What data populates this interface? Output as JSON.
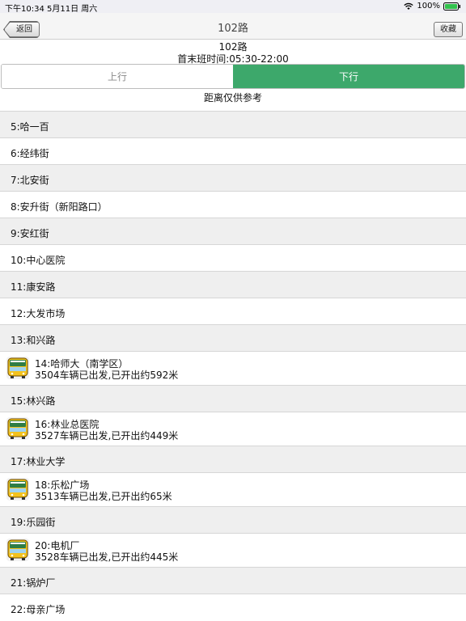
{
  "status_bar": {
    "time_date": "下午10:34   5月11日 周六",
    "battery": "100%"
  },
  "nav": {
    "back_label": "返回",
    "title": "102路",
    "favorite_label": "收藏"
  },
  "route": {
    "name": "102路",
    "hours": "首末班时间:05:30-22:00"
  },
  "direction_tabs": {
    "up": "上行",
    "down": "下行",
    "selected": "下行"
  },
  "note": "距离仅供参考",
  "colors": {
    "accent": "#3da86b",
    "row_alt": "#efefef"
  },
  "stops": [
    {
      "label": "5:哈一百"
    },
    {
      "label": "6:经纬街"
    },
    {
      "label": "7:北安街"
    },
    {
      "label": "8:安升街（新阳路口）"
    },
    {
      "label": "9:安红街"
    },
    {
      "label": "10:中心医院"
    },
    {
      "label": "11:康安路"
    },
    {
      "label": "12:大发市场"
    },
    {
      "label": "13:和兴路"
    },
    {
      "label": "14:哈师大（南学区）",
      "bus": "3504车辆已出发,已开出约592米",
      "icon": "bus-icon"
    },
    {
      "label": "15:林兴路"
    },
    {
      "label": "16:林业总医院",
      "bus": "3527车辆已出发,已开出约449米",
      "icon": "bus-icon"
    },
    {
      "label": "17:林业大学"
    },
    {
      "label": "18:乐松广场",
      "bus": "3513车辆已出发,已开出约65米",
      "icon": "bus-icon"
    },
    {
      "label": "19:乐园街"
    },
    {
      "label": "20:电机厂",
      "bus": "3528车辆已出发,已开出约445米",
      "icon": "bus-icon"
    },
    {
      "label": "21:锅炉厂"
    },
    {
      "label": "22:母亲广场"
    }
  ]
}
